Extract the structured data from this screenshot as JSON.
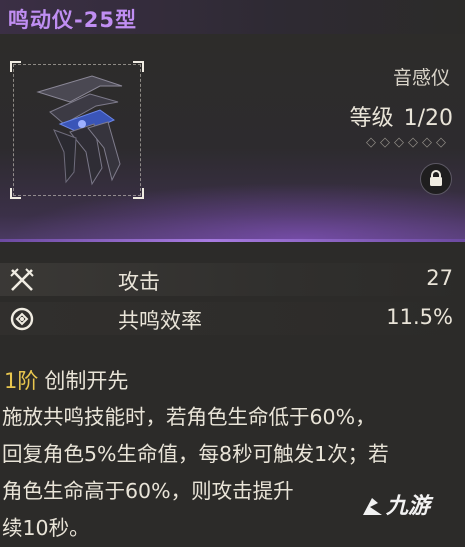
{
  "header": {
    "title": "鸣动仪-25型"
  },
  "item": {
    "type": "音感仪",
    "level_label": "等级",
    "level_value": "1/20",
    "stars": "◇◇◇◇◇◇"
  },
  "stats": [
    {
      "icon": "crossed-swords-icon",
      "name": "攻击",
      "value": "27"
    },
    {
      "icon": "resonance-target-icon",
      "name": "共鸣效率",
      "value": "11.5%"
    }
  ],
  "skill": {
    "rank": "1阶",
    "name": "创制开先",
    "description_lines": [
      "施放共鸣技能时，若角色生命低于60%，",
      "回复角色5%生命值，每8秒可触发1次；若",
      "角色生命高于60%，则攻击提升",
      "续10秒。"
    ]
  },
  "watermark": {
    "text": "九游"
  },
  "colors": {
    "accent_purple": "#c08ef2",
    "rank_gold": "#e8c64e"
  }
}
